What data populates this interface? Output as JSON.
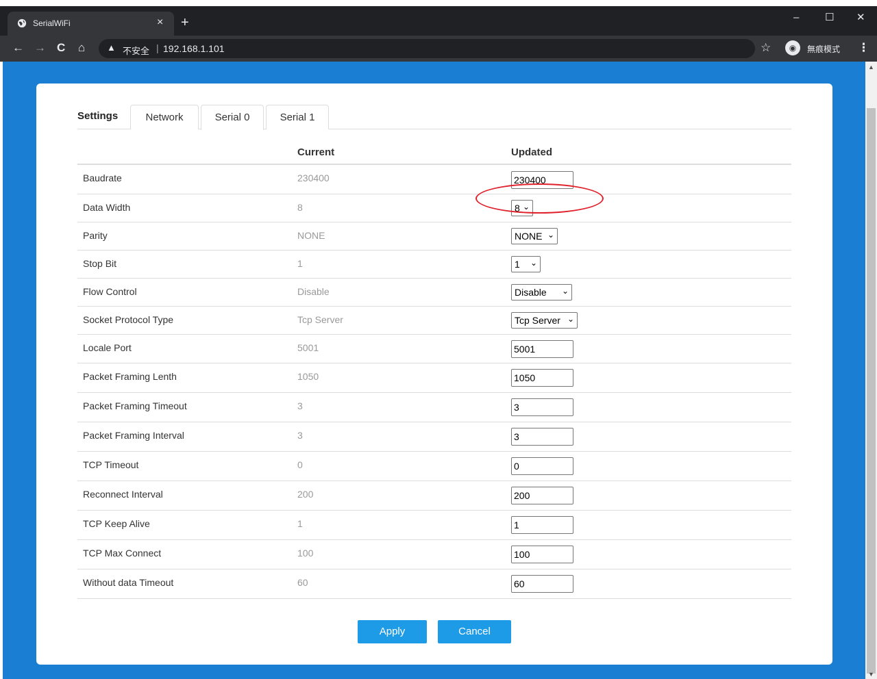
{
  "browser": {
    "tab_title": "SerialWiFi",
    "tab_close": "×",
    "new_tab": "+",
    "security_warning": "不安全",
    "address": "192.168.1.101",
    "incognito_label": "無痕模式",
    "back": "←",
    "forward": "→",
    "reload": "C",
    "home": "⌂",
    "bookmark": "☆",
    "menu": "⋮",
    "minimize": "–",
    "maximize": "☐",
    "close": "✕"
  },
  "tabs": {
    "settings_label": "Settings",
    "items": [
      {
        "label": "Network"
      },
      {
        "label": "Serial 0"
      },
      {
        "label": "Serial 1"
      }
    ]
  },
  "table": {
    "header_current": "Current",
    "header_updated": "Updated",
    "rows": [
      {
        "name": "Baudrate",
        "current": "230400",
        "updated": "230400"
      },
      {
        "name": "Data Width",
        "current": "8",
        "updated": "8"
      },
      {
        "name": "Parity",
        "current": "NONE",
        "updated": "NONE"
      },
      {
        "name": "Stop Bit",
        "current": "1",
        "updated": "1"
      },
      {
        "name": "Flow Control",
        "current": "Disable",
        "updated": "Disable"
      },
      {
        "name": "Socket Protocol Type",
        "current": "Tcp Server",
        "updated": "Tcp Server"
      },
      {
        "name": "Locale Port",
        "current": "5001",
        "updated": "5001"
      },
      {
        "name": "Packet Framing Lenth",
        "current": "1050",
        "updated": "1050"
      },
      {
        "name": "Packet Framing Timeout",
        "current": "3",
        "updated": "3"
      },
      {
        "name": "Packet Framing Interval",
        "current": "3",
        "updated": "3"
      },
      {
        "name": "TCP Timeout",
        "current": "0",
        "updated": "0"
      },
      {
        "name": "Reconnect Interval",
        "current": "200",
        "updated": "200"
      },
      {
        "name": "TCP Keep Alive",
        "current": "1",
        "updated": "1"
      },
      {
        "name": "TCP Max Connect",
        "current": "100",
        "updated": "100"
      },
      {
        "name": "Without data Timeout",
        "current": "60",
        "updated": "60"
      }
    ]
  },
  "actions": {
    "apply_label": "Apply",
    "cancel_label": "Cancel"
  },
  "colors": {
    "page_background": "#1a7fd3",
    "button": "#1e9be6",
    "highlight_ring": "#e0202a"
  }
}
